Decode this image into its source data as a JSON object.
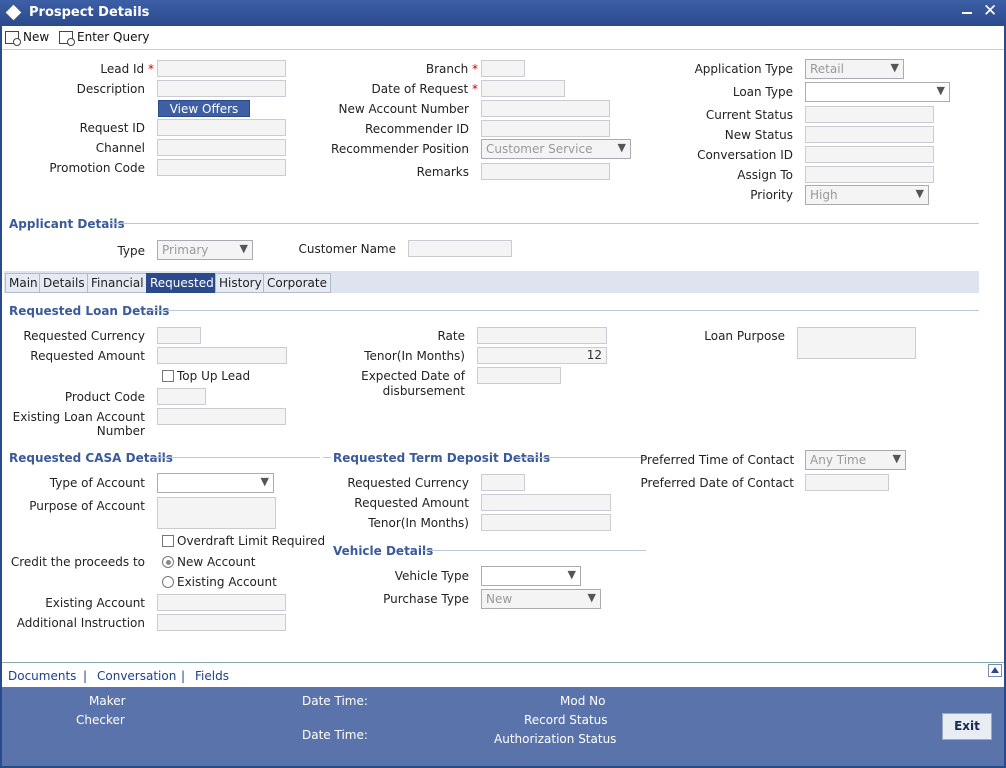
{
  "window": {
    "title": "Prospect Details"
  },
  "toolbar": {
    "new_label": "New",
    "enter_query_label": "Enter Query"
  },
  "header": {
    "lead_id_label": "Lead Id",
    "description_label": "Description",
    "view_offers_label": "View Offers",
    "request_id_label": "Request ID",
    "channel_label": "Channel",
    "promotion_code_label": "Promotion Code",
    "branch_label": "Branch",
    "date_of_request_label": "Date of Request",
    "new_account_number_label": "New Account Number",
    "recommender_id_label": "Recommender ID",
    "recommender_position_label": "Recommender Position",
    "recommender_position_value": "Customer Service",
    "remarks_label": "Remarks",
    "application_type_label": "Application Type",
    "application_type_value": "Retail",
    "loan_type_label": "Loan Type",
    "loan_type_value": "",
    "current_status_label": "Current Status",
    "new_status_label": "New Status",
    "conversation_id_label": "Conversation ID",
    "assign_to_label": "Assign To",
    "priority_label": "Priority",
    "priority_value": "High",
    "required_mark": "*"
  },
  "applicant": {
    "section_title": "Applicant Details",
    "type_label": "Type",
    "type_value": "Primary",
    "customer_name_label": "Customer Name"
  },
  "tabs": [
    {
      "label": "Main"
    },
    {
      "label": "Details"
    },
    {
      "label": "Financial"
    },
    {
      "label": "Requested"
    },
    {
      "label": "History"
    },
    {
      "label": "Corporate"
    }
  ],
  "requested_loan": {
    "section_title": "Requested Loan Details",
    "currency_label": "Requested Currency",
    "amount_label": "Requested Amount",
    "top_up_lead_label": "Top Up Lead",
    "product_code_label": "Product Code",
    "existing_loan_label_1": "Existing Loan Account",
    "existing_loan_label_2": "Number",
    "rate_label": "Rate",
    "tenor_label": "Tenor(In Months)",
    "tenor_value": "12",
    "expected_date_label_1": "Expected Date of",
    "expected_date_label_2": "disbursement",
    "loan_purpose_label": "Loan Purpose"
  },
  "casa": {
    "section_title": "Requested CASA Details",
    "type_of_account_label": "Type of Account",
    "purpose_label": "Purpose of Account",
    "overdraft_label": "Overdraft Limit Required",
    "credit_label": "Credit the proceeds to",
    "new_account_label": "New Account",
    "existing_account_radio_label": "Existing Account",
    "existing_account_label": "Existing Account",
    "additional_instruction_label": "Additional Instruction"
  },
  "term_deposit": {
    "section_title": "Requested Term Deposit Details",
    "currency_label": "Requested Currency",
    "amount_label": "Requested Amount",
    "tenor_label": "Tenor(In Months)"
  },
  "vehicle": {
    "section_title": "Vehicle Details",
    "vehicle_type_label": "Vehicle Type",
    "purchase_type_label": "Purchase Type",
    "purchase_type_value": "New"
  },
  "contact": {
    "preferred_time_label": "Preferred Time of Contact",
    "preferred_time_value": "Any Time",
    "preferred_date_label": "Preferred Date of Contact"
  },
  "links": {
    "documents": "Documents",
    "separator": "|",
    "conversation": "Conversation",
    "fields": "Fields"
  },
  "footer": {
    "maker_label": "Maker",
    "checker_label": "Checker",
    "datetime_label": "Date Time:",
    "mod_no_label": "Mod No",
    "record_status_label": "Record Status",
    "authorization_status_label": "Authorization Status",
    "exit_label": "Exit"
  },
  "colors": {
    "title_bar": "#2b4a8b",
    "footer": "#5a74ab",
    "section_heading": "#3a5a9a",
    "required": "#cc0000"
  }
}
